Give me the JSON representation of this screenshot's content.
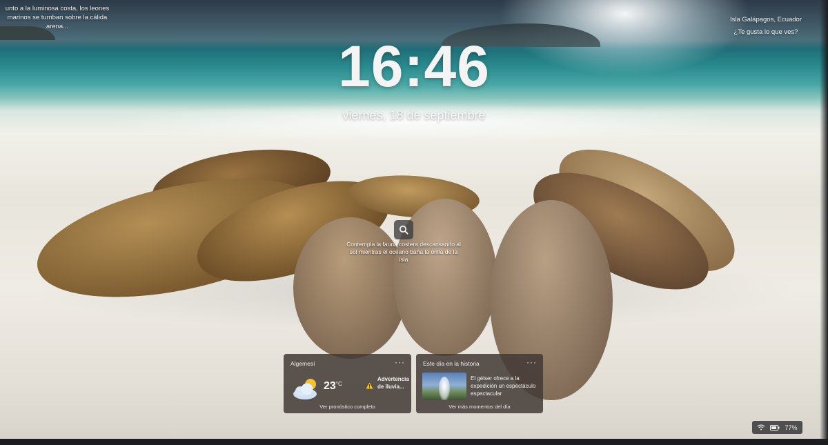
{
  "lockscreen": {
    "caption_left": "unto a la luminosa costa, los leones marinos se tumban sobre la cálida arena...",
    "caption_right_line1": "Isla Galápagos, Ecuador",
    "caption_right_line2": "¿Te gusta lo que ves?",
    "time": "16:46",
    "date": "viernes, 18 de septiembre",
    "image_description": "Contempla la fauna costera descansando al sol mientras el océano baña la orilla de la isla"
  },
  "widgets": {
    "weather": {
      "title": "Algemesí",
      "more": "···",
      "temperature": "23",
      "unit": "°C",
      "alert": "Advertencia de lluvia...",
      "footer": "Ver pronóstico completo",
      "icon": "partly-cloudy-icon"
    },
    "history": {
      "title": "Este día en la historia",
      "more": "···",
      "story": "El géiser ofrece a la expedición un espectáculo espectacular",
      "footer": "Ver más momentos del día",
      "icon": "geyser-thumbnail"
    }
  },
  "tray": {
    "battery": "77%",
    "icons": [
      "wifi-icon",
      "battery-icon"
    ]
  },
  "colors": {
    "widget_bg": "#423a36",
    "text": "#f4f4f4",
    "alert": "#f5c518"
  }
}
